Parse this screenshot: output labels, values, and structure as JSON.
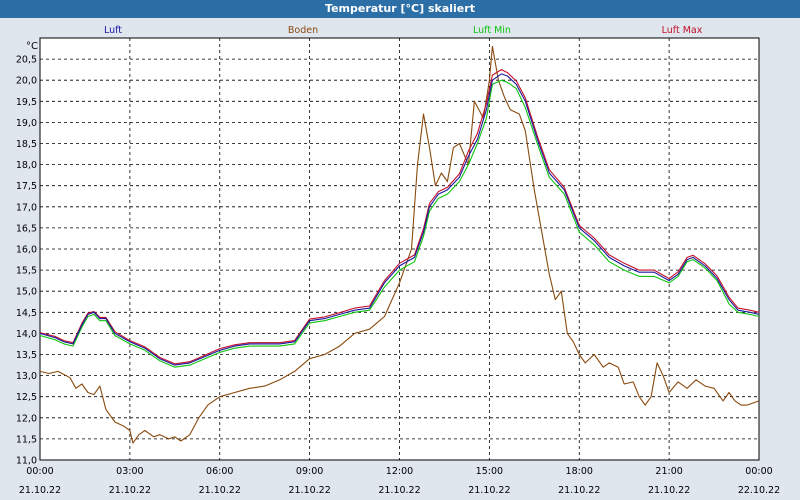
{
  "window": {
    "title": "Temperatur [°C] skaliert"
  },
  "chart_data": {
    "type": "line",
    "title": "Temperatur [°C] skaliert",
    "ylabel": "°C",
    "ylim": [
      11.0,
      21.0
    ],
    "y_ticks": [
      "11,0",
      "11,5",
      "12,0",
      "12,5",
      "13,0",
      "13,5",
      "14,0",
      "14,5",
      "15,0",
      "15,5",
      "16,0",
      "16,5",
      "17,0",
      "17,5",
      "18,0",
      "18,5",
      "19,0",
      "19,5",
      "20,0",
      "20,5"
    ],
    "x_range_hours": [
      0,
      24
    ],
    "x_ticks": [
      {
        "time": "00:00",
        "date": "21.10.22"
      },
      {
        "time": "03:00",
        "date": "21.10.22"
      },
      {
        "time": "06:00",
        "date": "21.10.22"
      },
      {
        "time": "09:00",
        "date": "21.10.22"
      },
      {
        "time": "12:00",
        "date": "21.10.22"
      },
      {
        "time": "15:00",
        "date": "21.10.22"
      },
      {
        "time": "18:00",
        "date": "21.10.22"
      },
      {
        "time": "21:00",
        "date": "21.10.22"
      },
      {
        "time": "00:00",
        "date": "22.10.22"
      }
    ],
    "grid": true,
    "legend_position": "top",
    "series": [
      {
        "name": "Luft",
        "color": "#1a1aa0",
        "points": [
          [
            0,
            14.0
          ],
          [
            0.5,
            13.9
          ],
          [
            0.8,
            13.8
          ],
          [
            1.1,
            13.75
          ],
          [
            1.4,
            14.2
          ],
          [
            1.6,
            14.45
          ],
          [
            1.8,
            14.5
          ],
          [
            2.0,
            14.35
          ],
          [
            2.2,
            14.35
          ],
          [
            2.5,
            14.0
          ],
          [
            3.0,
            13.8
          ],
          [
            3.5,
            13.65
          ],
          [
            4.0,
            13.4
          ],
          [
            4.5,
            13.25
          ],
          [
            5.0,
            13.3
          ],
          [
            5.5,
            13.45
          ],
          [
            6.0,
            13.6
          ],
          [
            6.5,
            13.7
          ],
          [
            7.0,
            13.75
          ],
          [
            7.5,
            13.75
          ],
          [
            8.0,
            13.75
          ],
          [
            8.5,
            13.8
          ],
          [
            9.0,
            14.3
          ],
          [
            9.5,
            14.35
          ],
          [
            10.0,
            14.45
          ],
          [
            10.5,
            14.55
          ],
          [
            11.0,
            14.6
          ],
          [
            11.5,
            15.2
          ],
          [
            12.0,
            15.6
          ],
          [
            12.5,
            15.8
          ],
          [
            12.8,
            16.4
          ],
          [
            13.0,
            17.0
          ],
          [
            13.3,
            17.3
          ],
          [
            13.6,
            17.4
          ],
          [
            14.0,
            17.7
          ],
          [
            14.3,
            18.2
          ],
          [
            14.6,
            18.6
          ],
          [
            14.9,
            19.3
          ],
          [
            15.1,
            20.0
          ],
          [
            15.4,
            20.15
          ],
          [
            15.6,
            20.1
          ],
          [
            15.9,
            19.9
          ],
          [
            16.2,
            19.5
          ],
          [
            16.6,
            18.6
          ],
          [
            17.0,
            17.8
          ],
          [
            17.5,
            17.4
          ],
          [
            18.0,
            16.5
          ],
          [
            18.5,
            16.2
          ],
          [
            19.0,
            15.8
          ],
          [
            19.5,
            15.6
          ],
          [
            20.0,
            15.45
          ],
          [
            20.5,
            15.45
          ],
          [
            21.0,
            15.25
          ],
          [
            21.3,
            15.4
          ],
          [
            21.6,
            15.75
          ],
          [
            21.8,
            15.8
          ],
          [
            22.2,
            15.6
          ],
          [
            22.6,
            15.3
          ],
          [
            23.0,
            14.8
          ],
          [
            23.3,
            14.55
          ],
          [
            23.7,
            14.5
          ],
          [
            24.0,
            14.45
          ]
        ]
      },
      {
        "name": "Boden",
        "color": "#8a4a0f",
        "points": [
          [
            0,
            13.1
          ],
          [
            0.3,
            13.05
          ],
          [
            0.6,
            13.1
          ],
          [
            1.0,
            12.95
          ],
          [
            1.2,
            12.7
          ],
          [
            1.4,
            12.8
          ],
          [
            1.6,
            12.6
          ],
          [
            1.8,
            12.55
          ],
          [
            2.0,
            12.75
          ],
          [
            2.2,
            12.2
          ],
          [
            2.5,
            11.9
          ],
          [
            2.8,
            11.8
          ],
          [
            3.0,
            11.7
          ],
          [
            3.1,
            11.4
          ],
          [
            3.3,
            11.6
          ],
          [
            3.5,
            11.7
          ],
          [
            3.8,
            11.55
          ],
          [
            4.0,
            11.6
          ],
          [
            4.3,
            11.5
          ],
          [
            4.5,
            11.55
          ],
          [
            4.7,
            11.45
          ],
          [
            5.0,
            11.6
          ],
          [
            5.3,
            12.0
          ],
          [
            5.6,
            12.3
          ],
          [
            6.0,
            12.5
          ],
          [
            6.5,
            12.6
          ],
          [
            7.0,
            12.7
          ],
          [
            7.5,
            12.75
          ],
          [
            8.0,
            12.9
          ],
          [
            8.5,
            13.1
          ],
          [
            9.0,
            13.4
          ],
          [
            9.5,
            13.5
          ],
          [
            10.0,
            13.7
          ],
          [
            10.5,
            14.0
          ],
          [
            11.0,
            14.1
          ],
          [
            11.5,
            14.4
          ],
          [
            12.0,
            15.2
          ],
          [
            12.4,
            16.0
          ],
          [
            12.6,
            18.0
          ],
          [
            12.8,
            19.2
          ],
          [
            13.0,
            18.4
          ],
          [
            13.2,
            17.5
          ],
          [
            13.4,
            17.8
          ],
          [
            13.6,
            17.6
          ],
          [
            13.8,
            18.4
          ],
          [
            14.0,
            18.5
          ],
          [
            14.3,
            18.0
          ],
          [
            14.5,
            19.5
          ],
          [
            14.8,
            19.1
          ],
          [
            15.0,
            20.0
          ],
          [
            15.1,
            20.8
          ],
          [
            15.3,
            20.0
          ],
          [
            15.5,
            19.6
          ],
          [
            15.7,
            19.3
          ],
          [
            16.0,
            19.2
          ],
          [
            16.2,
            18.8
          ],
          [
            16.5,
            17.4
          ],
          [
            16.8,
            16.2
          ],
          [
            17.0,
            15.4
          ],
          [
            17.2,
            14.8
          ],
          [
            17.4,
            15.0
          ],
          [
            17.6,
            14.0
          ],
          [
            17.8,
            13.8
          ],
          [
            18.0,
            13.5
          ],
          [
            18.2,
            13.3
          ],
          [
            18.5,
            13.5
          ],
          [
            18.8,
            13.2
          ],
          [
            19.0,
            13.3
          ],
          [
            19.3,
            13.2
          ],
          [
            19.5,
            12.8
          ],
          [
            19.8,
            12.85
          ],
          [
            20.0,
            12.5
          ],
          [
            20.2,
            12.3
          ],
          [
            20.4,
            12.5
          ],
          [
            20.6,
            13.3
          ],
          [
            20.8,
            13.0
          ],
          [
            21.0,
            12.6
          ],
          [
            21.3,
            12.85
          ],
          [
            21.6,
            12.7
          ],
          [
            21.9,
            12.9
          ],
          [
            22.2,
            12.75
          ],
          [
            22.5,
            12.7
          ],
          [
            22.8,
            12.4
          ],
          [
            23.0,
            12.6
          ],
          [
            23.2,
            12.4
          ],
          [
            23.4,
            12.3
          ],
          [
            23.6,
            12.3
          ],
          [
            24.0,
            12.4
          ]
        ]
      },
      {
        "name": "Luft Min",
        "color": "#0fc40f",
        "points": [
          [
            0,
            13.95
          ],
          [
            0.5,
            13.85
          ],
          [
            0.8,
            13.75
          ],
          [
            1.1,
            13.7
          ],
          [
            1.4,
            14.15
          ],
          [
            1.6,
            14.4
          ],
          [
            1.8,
            14.45
          ],
          [
            2.0,
            14.3
          ],
          [
            2.2,
            14.3
          ],
          [
            2.5,
            13.95
          ],
          [
            3.0,
            13.75
          ],
          [
            3.5,
            13.6
          ],
          [
            4.0,
            13.35
          ],
          [
            4.5,
            13.2
          ],
          [
            5.0,
            13.25
          ],
          [
            5.5,
            13.4
          ],
          [
            6.0,
            13.55
          ],
          [
            6.5,
            13.65
          ],
          [
            7.0,
            13.7
          ],
          [
            7.5,
            13.7
          ],
          [
            8.0,
            13.7
          ],
          [
            8.5,
            13.75
          ],
          [
            9.0,
            14.25
          ],
          [
            9.5,
            14.3
          ],
          [
            10.0,
            14.4
          ],
          [
            10.5,
            14.5
          ],
          [
            11.0,
            14.55
          ],
          [
            11.5,
            15.1
          ],
          [
            12.0,
            15.5
          ],
          [
            12.5,
            15.7
          ],
          [
            12.8,
            16.3
          ],
          [
            13.0,
            16.9
          ],
          [
            13.3,
            17.2
          ],
          [
            13.6,
            17.3
          ],
          [
            14.0,
            17.6
          ],
          [
            14.3,
            18.0
          ],
          [
            14.6,
            18.5
          ],
          [
            14.9,
            19.1
          ],
          [
            15.1,
            19.9
          ],
          [
            15.4,
            20.0
          ],
          [
            15.6,
            19.95
          ],
          [
            15.9,
            19.8
          ],
          [
            16.2,
            19.35
          ],
          [
            16.6,
            18.5
          ],
          [
            17.0,
            17.7
          ],
          [
            17.5,
            17.3
          ],
          [
            18.0,
            16.4
          ],
          [
            18.5,
            16.1
          ],
          [
            19.0,
            15.7
          ],
          [
            19.5,
            15.5
          ],
          [
            20.0,
            15.35
          ],
          [
            20.5,
            15.35
          ],
          [
            21.0,
            15.2
          ],
          [
            21.3,
            15.35
          ],
          [
            21.6,
            15.7
          ],
          [
            21.8,
            15.75
          ],
          [
            22.2,
            15.55
          ],
          [
            22.6,
            15.25
          ],
          [
            23.0,
            14.7
          ],
          [
            23.3,
            14.5
          ],
          [
            23.7,
            14.45
          ],
          [
            24.0,
            14.4
          ]
        ]
      },
      {
        "name": "Luft Max",
        "color": "#c4102a",
        "points": [
          [
            0,
            14.02
          ],
          [
            0.5,
            13.93
          ],
          [
            0.8,
            13.83
          ],
          [
            1.1,
            13.78
          ],
          [
            1.4,
            14.24
          ],
          [
            1.6,
            14.48
          ],
          [
            1.8,
            14.52
          ],
          [
            2.0,
            14.38
          ],
          [
            2.2,
            14.38
          ],
          [
            2.5,
            14.04
          ],
          [
            3.0,
            13.83
          ],
          [
            3.5,
            13.68
          ],
          [
            4.0,
            13.43
          ],
          [
            4.5,
            13.28
          ],
          [
            5.0,
            13.33
          ],
          [
            5.5,
            13.48
          ],
          [
            6.0,
            13.64
          ],
          [
            6.5,
            13.73
          ],
          [
            7.0,
            13.78
          ],
          [
            7.5,
            13.78
          ],
          [
            8.0,
            13.78
          ],
          [
            8.5,
            13.83
          ],
          [
            9.0,
            14.34
          ],
          [
            9.5,
            14.39
          ],
          [
            10.0,
            14.49
          ],
          [
            10.5,
            14.6
          ],
          [
            11.0,
            14.65
          ],
          [
            11.5,
            15.25
          ],
          [
            12.0,
            15.66
          ],
          [
            12.5,
            15.86
          ],
          [
            12.8,
            16.48
          ],
          [
            13.0,
            17.08
          ],
          [
            13.3,
            17.36
          ],
          [
            13.6,
            17.46
          ],
          [
            14.0,
            17.78
          ],
          [
            14.3,
            18.32
          ],
          [
            14.6,
            18.74
          ],
          [
            14.9,
            19.45
          ],
          [
            15.1,
            20.12
          ],
          [
            15.4,
            20.25
          ],
          [
            15.6,
            20.18
          ],
          [
            15.9,
            19.98
          ],
          [
            16.2,
            19.58
          ],
          [
            16.6,
            18.68
          ],
          [
            17.0,
            17.88
          ],
          [
            17.5,
            17.46
          ],
          [
            18.0,
            16.56
          ],
          [
            18.5,
            16.26
          ],
          [
            19.0,
            15.86
          ],
          [
            19.5,
            15.66
          ],
          [
            20.0,
            15.5
          ],
          [
            20.5,
            15.5
          ],
          [
            21.0,
            15.3
          ],
          [
            21.3,
            15.46
          ],
          [
            21.6,
            15.8
          ],
          [
            21.8,
            15.85
          ],
          [
            22.2,
            15.65
          ],
          [
            22.6,
            15.36
          ],
          [
            23.0,
            14.86
          ],
          [
            23.3,
            14.6
          ],
          [
            23.7,
            14.55
          ],
          [
            24.0,
            14.5
          ]
        ]
      }
    ]
  }
}
